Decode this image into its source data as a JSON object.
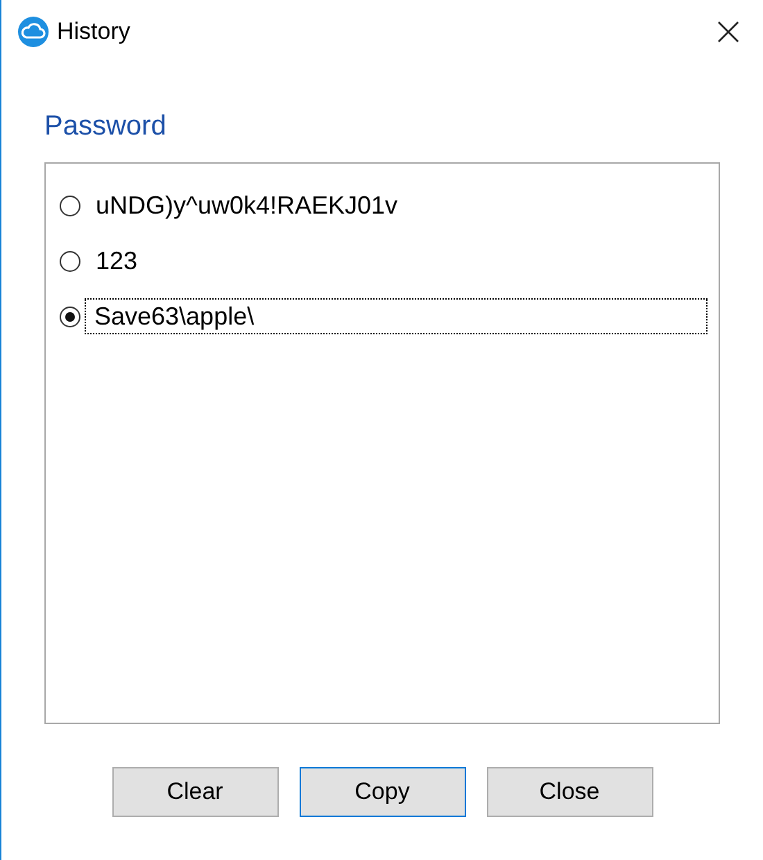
{
  "window": {
    "title": "History"
  },
  "group_label": "Password",
  "entries": [
    {
      "text": "uNDG)y^uw0k4!RAEKJ01v",
      "selected": false,
      "focused": false
    },
    {
      "text": "123",
      "selected": false,
      "focused": false
    },
    {
      "text": "Save63\\apple\\",
      "selected": true,
      "focused": true
    }
  ],
  "buttons": [
    {
      "label": "Clear",
      "default": false
    },
    {
      "label": "Copy",
      "default": true
    },
    {
      "label": "Close",
      "default": false
    }
  ]
}
